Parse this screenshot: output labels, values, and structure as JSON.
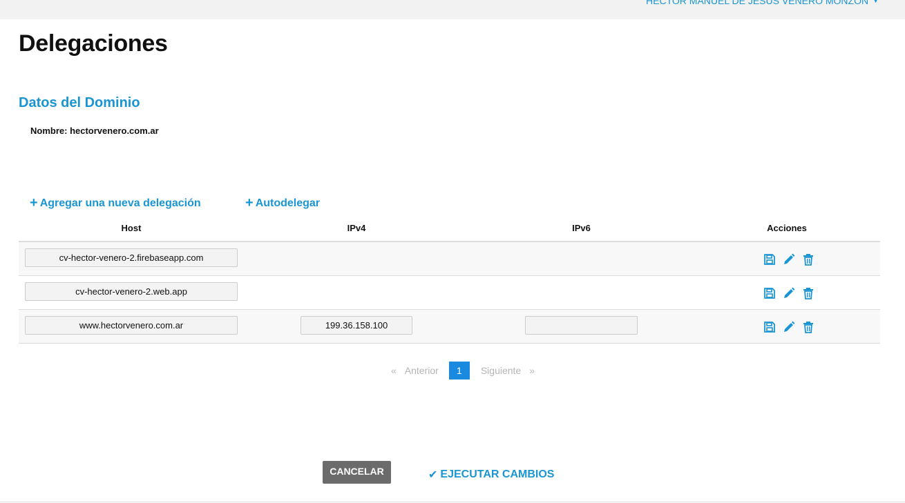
{
  "header": {
    "user_name": "HECTOR MANUEL DE JESUS VENERO MONZON",
    "user_caret": "▼"
  },
  "page": {
    "title": "Delegaciones"
  },
  "domain": {
    "section_title": "Datos del Dominio",
    "name_label": "Nombre:",
    "name_value": "hectorvenero.com.ar"
  },
  "actions": {
    "add_label": "Agregar una nueva delegación",
    "auto_label": "Autodelegar",
    "plus_icon": "+"
  },
  "table": {
    "columns": {
      "host": "Host",
      "ipv4": "IPv4",
      "ipv6": "IPv6",
      "actions": "Acciones"
    },
    "rows": [
      {
        "host": "cv-hector-venero-2.firebaseapp.com"
      },
      {
        "host": "cv-hector-venero-2.web.app"
      },
      {
        "host": "www.hectorvenero.com.ar",
        "ipv4": "199.36.158.100",
        "ipv6": ""
      }
    ],
    "row_icons": [
      "save-icon",
      "edit-pencil-icon",
      "trash-icon"
    ]
  },
  "pagination": {
    "prev_arrow": "«",
    "prev_label": "Anterior",
    "current_page": "1",
    "next_label": "Siguiente",
    "next_arrow": "»"
  },
  "footer": {
    "cancel_label": "CANCELAR",
    "execute_label": "EJECUTAR CAMBIOS",
    "check_icon": "✔"
  },
  "colors": {
    "accent": "#1a95d3",
    "page_active": "#1a8ae0",
    "cancel_bg": "#6b6b6b",
    "topbar": "#f2f2f2"
  }
}
